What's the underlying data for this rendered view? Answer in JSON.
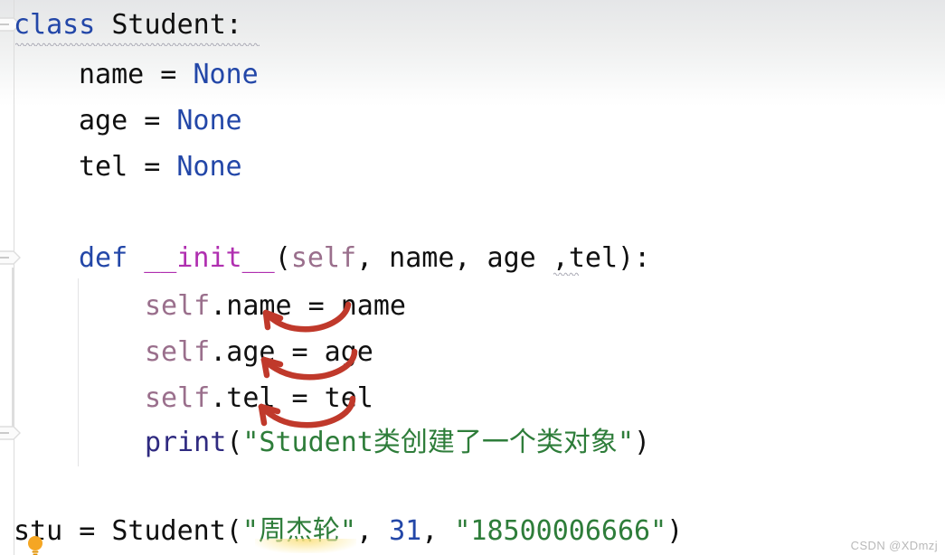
{
  "editor": {
    "language": "python",
    "watermark": "CSDN @XDmzj",
    "colors": {
      "background": "#ffffff",
      "keyword": "#2347a8",
      "magic_method": "#b02fb0",
      "self_keyword": "#9a6f8c",
      "function": "#2f2a80",
      "string": "#2e7d3a",
      "number": "#2347a8",
      "plain_text": "#101010",
      "annotation_arrow": "#c0392b",
      "squiggle_underline": "#a9a9b4",
      "gutter_line": "#dcdcdc",
      "indent_guide": "#e3e3e5",
      "bulb": "#f0a500"
    },
    "lines": [
      {
        "number": 1,
        "indent": 0,
        "tokens": [
          {
            "text": "class ",
            "type": "kw"
          },
          {
            "text": "Student:",
            "type": "plain"
          }
        ]
      },
      {
        "number": 2,
        "indent": 1,
        "tokens": [
          {
            "text": "name = ",
            "type": "plain"
          },
          {
            "text": "None",
            "type": "kw"
          }
        ]
      },
      {
        "number": 3,
        "indent": 1,
        "tokens": [
          {
            "text": "age = ",
            "type": "plain"
          },
          {
            "text": "None",
            "type": "kw"
          }
        ]
      },
      {
        "number": 4,
        "indent": 1,
        "tokens": [
          {
            "text": "tel = ",
            "type": "plain"
          },
          {
            "text": "None",
            "type": "kw"
          }
        ]
      },
      {
        "number": 5,
        "indent": 0,
        "tokens": []
      },
      {
        "number": 6,
        "indent": 1,
        "tokens": [
          {
            "text": "def ",
            "type": "kw"
          },
          {
            "text": "__init__",
            "type": "magic"
          },
          {
            "text": "(",
            "type": "plain"
          },
          {
            "text": "self",
            "type": "selfkw"
          },
          {
            "text": ", name, age ,tel):",
            "type": "plain"
          }
        ]
      },
      {
        "number": 7,
        "indent": 2,
        "tokens": [
          {
            "text": "self",
            "type": "selfkw"
          },
          {
            "text": ".name = name",
            "type": "plain"
          }
        ]
      },
      {
        "number": 8,
        "indent": 2,
        "tokens": [
          {
            "text": "self",
            "type": "selfkw"
          },
          {
            "text": ".age = age",
            "type": "plain"
          }
        ]
      },
      {
        "number": 9,
        "indent": 2,
        "tokens": [
          {
            "text": "self",
            "type": "selfkw"
          },
          {
            "text": ".tel = tel",
            "type": "plain"
          }
        ]
      },
      {
        "number": 10,
        "indent": 2,
        "tokens": [
          {
            "text": "print",
            "type": "func"
          },
          {
            "text": "(",
            "type": "plain"
          },
          {
            "text": "\"Student类创建了一个类对象\"",
            "type": "str"
          },
          {
            "text": ")",
            "type": "plain"
          }
        ]
      },
      {
        "number": 11,
        "indent": 0,
        "tokens": []
      },
      {
        "number": 12,
        "indent": 0,
        "tokens": [
          {
            "text": "stu = Student(",
            "type": "plain"
          },
          {
            "text": "\"周杰轮\"",
            "type": "str"
          },
          {
            "text": ", ",
            "type": "plain"
          },
          {
            "text": "31",
            "type": "num"
          },
          {
            "text": ", ",
            "type": "plain"
          },
          {
            "text": "\"18500006666\"",
            "type": "str"
          },
          {
            "text": ")",
            "type": "plain"
          }
        ]
      }
    ],
    "full_text": "class Student:\n    name = None\n    age = None\n    tel = None\n\n    def __init__(self, name, age ,tel):\n        self.name = name\n        self.age = age\n        self.tel = tel\n        print(\"Student类创建了一个类对象\")\n\nstu = Student(\"周杰轮\", 31, \"18500006666\")"
  },
  "gutter": {
    "fold_markers": [
      {
        "id": "fold-class",
        "line": 1,
        "state": "expanded",
        "glyph": "minus"
      },
      {
        "id": "fold-init",
        "line": 6,
        "state": "expanded",
        "glyph": "minus"
      },
      {
        "id": "fold-end",
        "line": 10,
        "state": "expanded",
        "glyph": "minus"
      }
    ]
  },
  "annotations": {
    "arrows": [
      {
        "id": "arrow-name",
        "from_token": "name",
        "to_token": "self.name",
        "color": "#c0392b"
      },
      {
        "id": "arrow-age",
        "from_token": "age",
        "to_token": "self.age",
        "color": "#c0392b"
      },
      {
        "id": "arrow-tel",
        "from_token": "tel",
        "to_token": "self.tel",
        "color": "#c0392b"
      }
    ],
    "squiggles": [
      {
        "id": "squiggle-class-line",
        "line": 1,
        "reason": "weak-warning"
      },
      {
        "id": "squiggle-age-space",
        "line": 6,
        "reason": "pep8-whitespace-before-comma"
      }
    ],
    "intention_bulb": {
      "id": "intention-bulb",
      "line": 12,
      "tooltip": "Show Context Actions"
    }
  }
}
